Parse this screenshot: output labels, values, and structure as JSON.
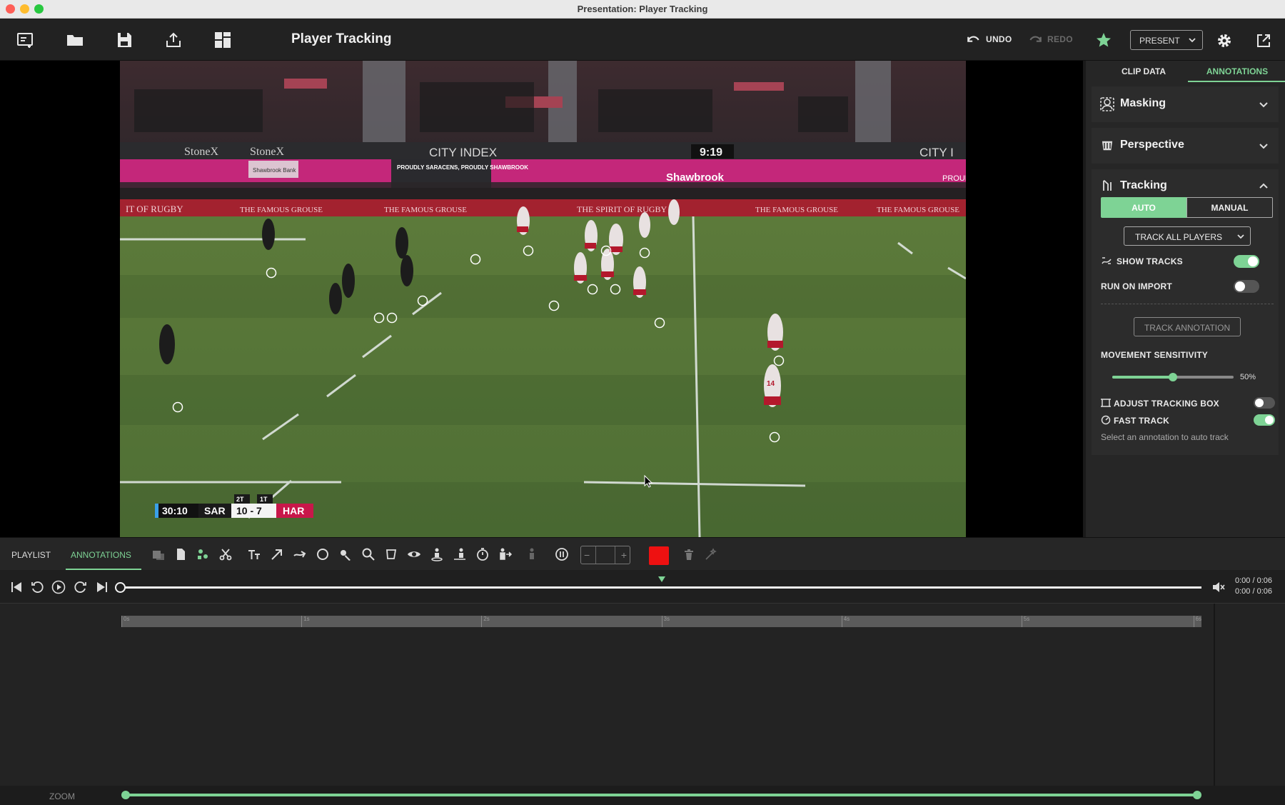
{
  "window": {
    "title": "Presentation: Player Tracking"
  },
  "toolbar": {
    "doc_title": "Player Tracking",
    "undo_label": "UNDO",
    "redo_label": "REDO",
    "present_label": "PRESENT",
    "icons": [
      "new-presentation-icon",
      "folder-icon",
      "save-icon",
      "export-icon",
      "layout-grid-icon",
      "undo-icon",
      "redo-icon",
      "star-icon",
      "gear-icon",
      "popout-icon"
    ]
  },
  "video": {
    "scoreboard": {
      "clock": "30:10",
      "home": "SAR",
      "score": "10 - 7",
      "away": "HAR",
      "home_tries": "2T",
      "away_tries": "1T"
    },
    "stadium_clock": "9:19",
    "banners": [
      "StoneX",
      "StoneX",
      "CITY INDEX",
      "CITY I",
      "PROUDLY SARACENS, PROUDLY SHAWBROOK",
      "Shawbrook Bank",
      "Shawbrook",
      "PROUD",
      "THE FAMOUS GROUSE",
      "THE FAMOUS GROUSE",
      "THE FAMOUS GROUSE",
      "THE FAMOUS GROUSE",
      "IT OF RUGBY",
      "THE SPIRIT OF RUGBY"
    ],
    "jersey_number": "14"
  },
  "panel": {
    "tabs": [
      "CLIP DATA",
      "ANNOTATIONS"
    ],
    "active_tab": "ANNOTATIONS",
    "masking_label": "Masking",
    "perspective_label": "Perspective",
    "tracking_label": "Tracking",
    "mode_auto": "AUTO",
    "mode_manual": "MANUAL",
    "track_select": "TRACK ALL PLAYERS",
    "show_tracks_label": "SHOW TRACKS",
    "show_tracks_on": true,
    "run_on_import_label": "RUN ON IMPORT",
    "run_on_import_on": false,
    "track_annotation_label": "TRACK ANNOTATION",
    "movement_sensitivity_label": "MOVEMENT SENSITIVITY",
    "movement_sensitivity_value": "50%",
    "movement_sensitivity": 0.5,
    "adjust_tracking_box_label": "ADJUST TRACKING BOX",
    "adjust_tracking_box_on": false,
    "fast_track_label": "FAST TRACK",
    "fast_track_on": true,
    "hint": "Select an annotation to auto track"
  },
  "bottom": {
    "tabs": [
      "PLAYLIST",
      "ANNOTATIONS"
    ],
    "active_tab": "ANNOTATIONS",
    "time_current": "0:00 / 0:06",
    "time_total": "0:00 / 0:06",
    "ruler_ticks": [
      "0s",
      "1s",
      "2s",
      "3s",
      "4s",
      "5s",
      "6s"
    ],
    "zoom_label": "ZOOM"
  },
  "colors": {
    "accent": "#7ed395",
    "record": "#ee1111",
    "bg": "#1e1e1e"
  }
}
